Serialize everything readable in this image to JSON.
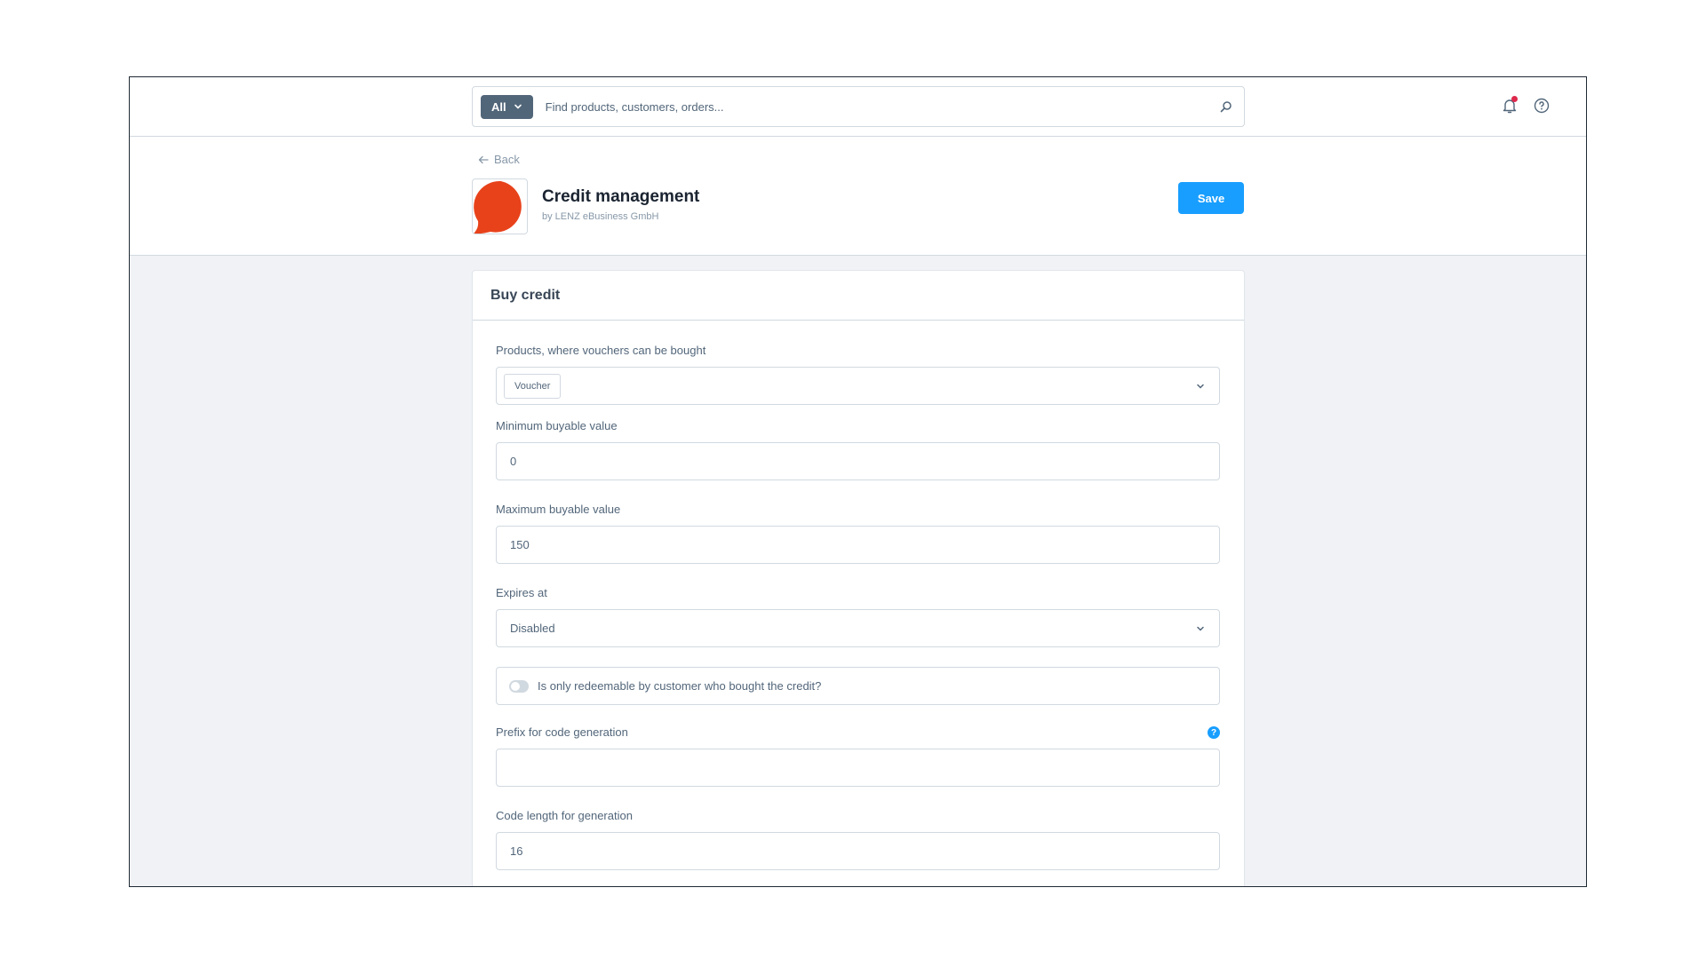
{
  "search": {
    "type_label": "All",
    "placeholder": "Find products, customers, orders..."
  },
  "header": {
    "back_label": "Back",
    "app_title": "Credit management",
    "app_vendor": "by LENZ eBusiness GmbH",
    "save_label": "Save",
    "logo_color": "#e8421b"
  },
  "card": {
    "title": "Buy credit",
    "fields": {
      "products": {
        "label": "Products, where vouchers can be bought",
        "chip": "Voucher"
      },
      "min_value": {
        "label": "Minimum buyable value",
        "value": "0"
      },
      "max_value": {
        "label": "Maximum buyable value",
        "value": "150"
      },
      "expires": {
        "label": "Expires at",
        "value": "Disabled"
      },
      "redeemable": {
        "label": "Is only redeemable by customer who bought the credit?",
        "checked": false
      },
      "prefix": {
        "label": "Prefix for code generation",
        "value": ""
      },
      "code_length": {
        "label": "Code length for generation",
        "value": "16"
      }
    }
  },
  "colors": {
    "primary": "#189eff",
    "notification": "#de294c"
  }
}
